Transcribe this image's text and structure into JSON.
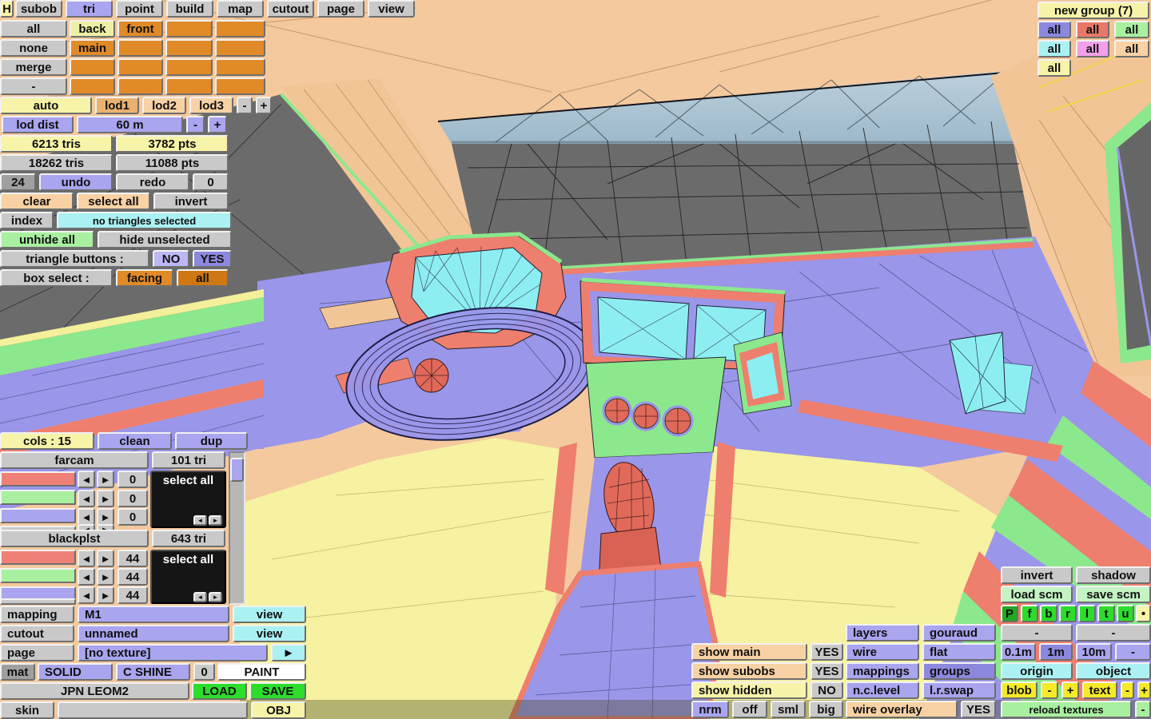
{
  "common": {
    "all": "all",
    "yes": "YES",
    "no": "NO",
    "view": "view",
    "dash": "-",
    "plus": "+",
    "left": "◄",
    "right": "►",
    "select_all": "select all"
  },
  "menu": {
    "h": "H",
    "subob": "subob",
    "tri": "tri",
    "point": "point",
    "build": "build",
    "map": "map",
    "cutout": "cutout",
    "page": "page",
    "view": "view"
  },
  "subob_grid": {
    "all": "all",
    "none": "none",
    "merge": "merge",
    "dash": "-",
    "back": "back",
    "front": "front",
    "main": "main"
  },
  "lod": {
    "auto": "auto",
    "lod1": "lod1",
    "lod2": "lod2",
    "lod3": "lod3",
    "dist_label": "lod dist",
    "dist_value": "60 m"
  },
  "stats": {
    "lod_tris": "6213 tris",
    "lod_pts": "3782 pts",
    "total_tris": "18262 tris",
    "total_pts": "11088 pts",
    "undo_count": "24",
    "undo": "undo",
    "redo": "redo",
    "redo_count": "0"
  },
  "selection": {
    "clear": "clear",
    "invert": "invert",
    "index": "index",
    "status": "no triangles selected",
    "unhide_all": "unhide all",
    "hide_unselected": "hide unselected",
    "triangle_buttons": "triangle buttons :",
    "box_select": "box select :",
    "facing": "facing"
  },
  "groups": {
    "title": "new group (7)"
  },
  "cols": {
    "header": "cols : 15",
    "clean": "clean",
    "dup": "dup",
    "farcam": {
      "name": "farcam",
      "tri": "101 tri",
      "v": [
        "0",
        "0",
        "0"
      ]
    },
    "blackplst": {
      "name": "blackplst",
      "tri": "643 tri",
      "v": [
        "44",
        "44",
        "44"
      ]
    }
  },
  "mapping": {
    "mapping": "mapping",
    "m1": "M1",
    "cutout": "cutout",
    "unnamed": "unnamed",
    "page": "page",
    "no_texture": "[no texture]",
    "next": "►",
    "mat": "mat",
    "solid": "SOLID",
    "cshine": "C SHINE",
    "zero": "0",
    "paint": "PAINT",
    "file": "JPN LEOM2",
    "load": "LOAD",
    "save": "SAVE",
    "skin": "skin",
    "obj": "OBJ"
  },
  "show": {
    "main": "show main",
    "subobs": "show subobs",
    "hidden": "show hidden",
    "nrm": "nrm",
    "off": "off",
    "sml": "sml",
    "big": "big"
  },
  "view_opts": {
    "layers": "layers",
    "gouraud": "gouraud",
    "wire": "wire",
    "flat": "flat",
    "mappings": "mappings",
    "groups": "groups",
    "nclevel": "n.c.level",
    "lrswap": "l.r.swap",
    "wire_overlay": "wire overlay"
  },
  "right": {
    "invert": "invert",
    "shadow": "shadow",
    "load_scm": "load scm",
    "save_scm": "save scm",
    "p": "P",
    "f": "f",
    "b": "b",
    "r": "r",
    "l": "l",
    "t": "t",
    "u": "u",
    "dot": "•",
    "m01": "0.1m",
    "m1": "1m",
    "m10": "10m",
    "origin": "origin",
    "object": "object",
    "blob": "blob",
    "text": "text",
    "reload": "reload textures"
  },
  "palette": {
    "accent_purple": "#a9a5ef",
    "selected_purple": "#8c88de",
    "slot_orange": "#e08a28",
    "accent_cyan": "#abf1f3",
    "accent_green": "#a8f0a0",
    "bright_green": "#2cdd2c",
    "salmon": "#ee8078",
    "panel_yellow": "#f7f3a8",
    "mesh_dash": "#9a96ea",
    "mesh_trim_red": "#ee7e6e",
    "mesh_floor": "#f6f2a2",
    "mesh_road": "#6b6b6b"
  }
}
